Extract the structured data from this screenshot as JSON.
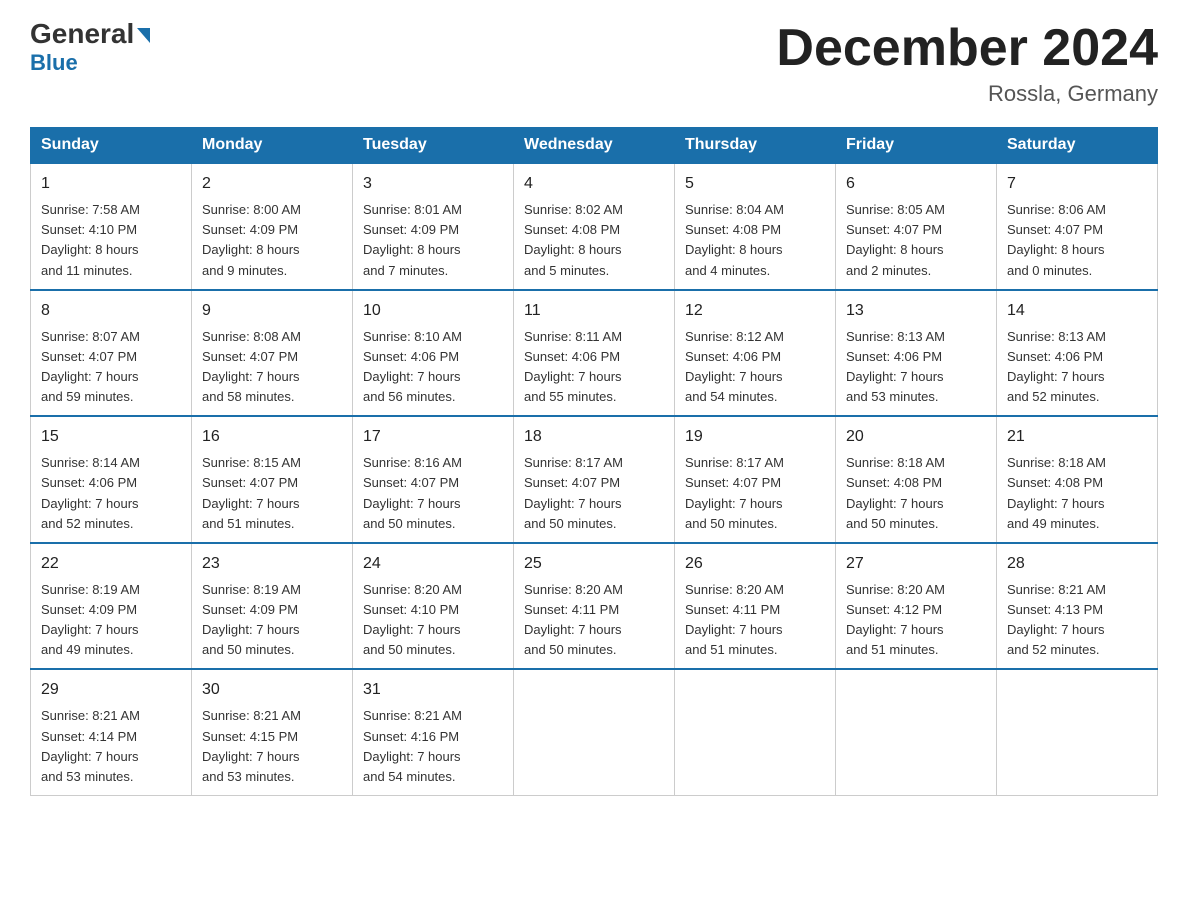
{
  "logo": {
    "part1": "General",
    "part2": "Blue"
  },
  "title": {
    "month": "December 2024",
    "location": "Rossla, Germany"
  },
  "days_header": [
    "Sunday",
    "Monday",
    "Tuesday",
    "Wednesday",
    "Thursday",
    "Friday",
    "Saturday"
  ],
  "weeks": [
    [
      {
        "day": "1",
        "info": "Sunrise: 7:58 AM\nSunset: 4:10 PM\nDaylight: 8 hours\nand 11 minutes."
      },
      {
        "day": "2",
        "info": "Sunrise: 8:00 AM\nSunset: 4:09 PM\nDaylight: 8 hours\nand 9 minutes."
      },
      {
        "day": "3",
        "info": "Sunrise: 8:01 AM\nSunset: 4:09 PM\nDaylight: 8 hours\nand 7 minutes."
      },
      {
        "day": "4",
        "info": "Sunrise: 8:02 AM\nSunset: 4:08 PM\nDaylight: 8 hours\nand 5 minutes."
      },
      {
        "day": "5",
        "info": "Sunrise: 8:04 AM\nSunset: 4:08 PM\nDaylight: 8 hours\nand 4 minutes."
      },
      {
        "day": "6",
        "info": "Sunrise: 8:05 AM\nSunset: 4:07 PM\nDaylight: 8 hours\nand 2 minutes."
      },
      {
        "day": "7",
        "info": "Sunrise: 8:06 AM\nSunset: 4:07 PM\nDaylight: 8 hours\nand 0 minutes."
      }
    ],
    [
      {
        "day": "8",
        "info": "Sunrise: 8:07 AM\nSunset: 4:07 PM\nDaylight: 7 hours\nand 59 minutes."
      },
      {
        "day": "9",
        "info": "Sunrise: 8:08 AM\nSunset: 4:07 PM\nDaylight: 7 hours\nand 58 minutes."
      },
      {
        "day": "10",
        "info": "Sunrise: 8:10 AM\nSunset: 4:06 PM\nDaylight: 7 hours\nand 56 minutes."
      },
      {
        "day": "11",
        "info": "Sunrise: 8:11 AM\nSunset: 4:06 PM\nDaylight: 7 hours\nand 55 minutes."
      },
      {
        "day": "12",
        "info": "Sunrise: 8:12 AM\nSunset: 4:06 PM\nDaylight: 7 hours\nand 54 minutes."
      },
      {
        "day": "13",
        "info": "Sunrise: 8:13 AM\nSunset: 4:06 PM\nDaylight: 7 hours\nand 53 minutes."
      },
      {
        "day": "14",
        "info": "Sunrise: 8:13 AM\nSunset: 4:06 PM\nDaylight: 7 hours\nand 52 minutes."
      }
    ],
    [
      {
        "day": "15",
        "info": "Sunrise: 8:14 AM\nSunset: 4:06 PM\nDaylight: 7 hours\nand 52 minutes."
      },
      {
        "day": "16",
        "info": "Sunrise: 8:15 AM\nSunset: 4:07 PM\nDaylight: 7 hours\nand 51 minutes."
      },
      {
        "day": "17",
        "info": "Sunrise: 8:16 AM\nSunset: 4:07 PM\nDaylight: 7 hours\nand 50 minutes."
      },
      {
        "day": "18",
        "info": "Sunrise: 8:17 AM\nSunset: 4:07 PM\nDaylight: 7 hours\nand 50 minutes."
      },
      {
        "day": "19",
        "info": "Sunrise: 8:17 AM\nSunset: 4:07 PM\nDaylight: 7 hours\nand 50 minutes."
      },
      {
        "day": "20",
        "info": "Sunrise: 8:18 AM\nSunset: 4:08 PM\nDaylight: 7 hours\nand 50 minutes."
      },
      {
        "day": "21",
        "info": "Sunrise: 8:18 AM\nSunset: 4:08 PM\nDaylight: 7 hours\nand 49 minutes."
      }
    ],
    [
      {
        "day": "22",
        "info": "Sunrise: 8:19 AM\nSunset: 4:09 PM\nDaylight: 7 hours\nand 49 minutes."
      },
      {
        "day": "23",
        "info": "Sunrise: 8:19 AM\nSunset: 4:09 PM\nDaylight: 7 hours\nand 50 minutes."
      },
      {
        "day": "24",
        "info": "Sunrise: 8:20 AM\nSunset: 4:10 PM\nDaylight: 7 hours\nand 50 minutes."
      },
      {
        "day": "25",
        "info": "Sunrise: 8:20 AM\nSunset: 4:11 PM\nDaylight: 7 hours\nand 50 minutes."
      },
      {
        "day": "26",
        "info": "Sunrise: 8:20 AM\nSunset: 4:11 PM\nDaylight: 7 hours\nand 51 minutes."
      },
      {
        "day": "27",
        "info": "Sunrise: 8:20 AM\nSunset: 4:12 PM\nDaylight: 7 hours\nand 51 minutes."
      },
      {
        "day": "28",
        "info": "Sunrise: 8:21 AM\nSunset: 4:13 PM\nDaylight: 7 hours\nand 52 minutes."
      }
    ],
    [
      {
        "day": "29",
        "info": "Sunrise: 8:21 AM\nSunset: 4:14 PM\nDaylight: 7 hours\nand 53 minutes."
      },
      {
        "day": "30",
        "info": "Sunrise: 8:21 AM\nSunset: 4:15 PM\nDaylight: 7 hours\nand 53 minutes."
      },
      {
        "day": "31",
        "info": "Sunrise: 8:21 AM\nSunset: 4:16 PM\nDaylight: 7 hours\nand 54 minutes."
      },
      {
        "day": "",
        "info": ""
      },
      {
        "day": "",
        "info": ""
      },
      {
        "day": "",
        "info": ""
      },
      {
        "day": "",
        "info": ""
      }
    ]
  ]
}
